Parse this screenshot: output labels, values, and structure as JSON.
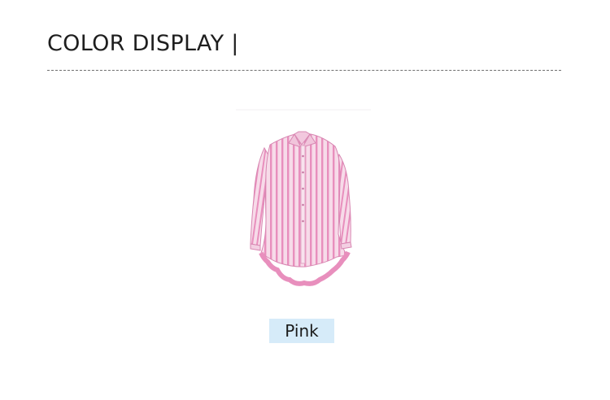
{
  "section": {
    "title": "COLOR DISPLAY |"
  },
  "product": {
    "color_name": "Pink",
    "image_icon": "pink-striped-shirt-icon"
  },
  "colors": {
    "label_background": "#d6ebf9",
    "shirt_base": "#f7dbe9",
    "shirt_stripe": "#e88fbd"
  }
}
